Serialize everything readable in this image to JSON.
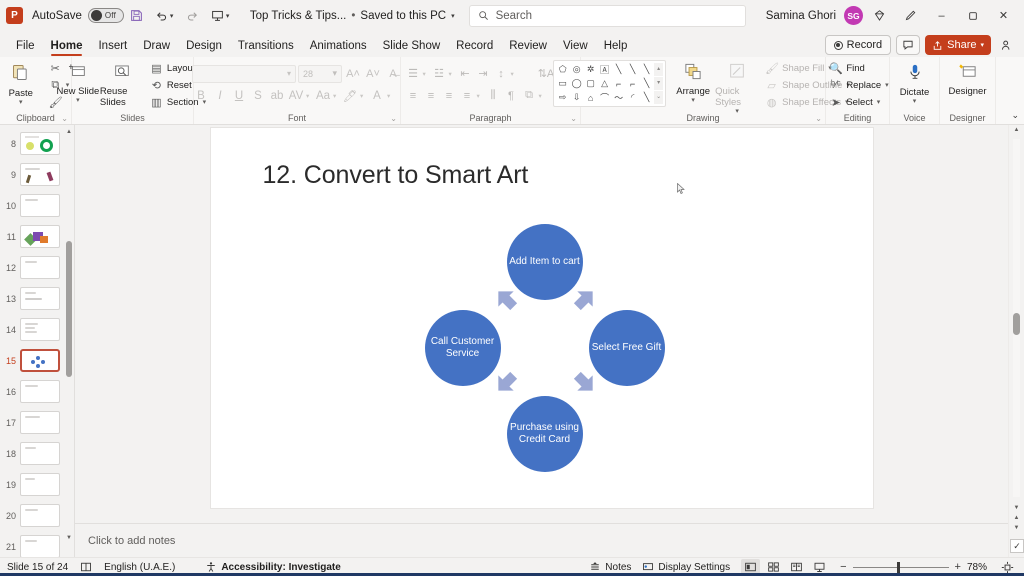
{
  "titlebar": {
    "app_logo": "powerpoint-logo",
    "autosave_label": "AutoSave",
    "autosave_state": "Off",
    "save_icon": "save-icon",
    "undo_icon": "undo-icon",
    "redo_icon": "redo-icon",
    "present_icon": "start-presentation-icon",
    "more_icon": "more-commands-icon",
    "document_title": "Top Tricks & Tips...",
    "save_status": "Saved to this PC",
    "search_placeholder": "Search",
    "search_icon": "search-icon",
    "user_name": "Samina Ghori",
    "user_initials": "SG",
    "diamond_icon": "microsoft-365-icon",
    "pen_icon": "ink-icon",
    "minimize": "–",
    "restore": "❐",
    "close": "✕"
  },
  "tabs": [
    {
      "label": "File",
      "active": false
    },
    {
      "label": "Home",
      "active": true
    },
    {
      "label": "Insert",
      "active": false
    },
    {
      "label": "Draw",
      "active": false
    },
    {
      "label": "Design",
      "active": false
    },
    {
      "label": "Transitions",
      "active": false
    },
    {
      "label": "Animations",
      "active": false
    },
    {
      "label": "Slide Show",
      "active": false
    },
    {
      "label": "Record",
      "active": false
    },
    {
      "label": "Review",
      "active": false
    },
    {
      "label": "View",
      "active": false
    },
    {
      "label": "Help",
      "active": false
    }
  ],
  "tab_actions": {
    "record_label": "Record",
    "comment_icon": "comment-icon",
    "share_label": "Share",
    "share_color": "#c43e1c",
    "people_icon": "share-people-icon"
  },
  "ribbon": {
    "groups": [
      {
        "name": "Clipboard",
        "label": "Clipboard",
        "paste_label": "Paste",
        "cut_icon": "cut-icon",
        "copy_icon": "copy-icon",
        "format_painter_icon": "format-painter-icon",
        "paste_icon": "paste-icon"
      },
      {
        "name": "Slides",
        "label": "Slides",
        "new_slide_label": "New Slide",
        "reuse_slides_label": "Reuse Slides",
        "layout_label": "Layout",
        "reset_label": "Reset",
        "section_label": "Section"
      },
      {
        "name": "Font",
        "label": "Font",
        "font_name": "",
        "font_size": "28",
        "grow_font_icon": "increase-font-size-icon",
        "shrink_font_icon": "decrease-font-size-icon",
        "clear_format_icon": "clear-formatting-icon",
        "bold": "B",
        "italic": "I",
        "underline": "U",
        "shadow": "S",
        "strikethrough_icon": "strikethrough-icon",
        "char_spacing_icon": "character-spacing-icon",
        "change_case": "Aa",
        "highlight_icon": "text-highlight-icon",
        "font_color_icon": "font-color-icon",
        "disabled": true
      },
      {
        "name": "Paragraph",
        "label": "Paragraph",
        "disabled": true
      },
      {
        "name": "Drawing",
        "label": "Drawing",
        "arrange_label": "Arrange",
        "quick_styles_label": "Quick Styles",
        "shape_fill_label": "Shape Fill",
        "shape_outline_label": "Shape Outline",
        "shape_effects_label": "Shape Effects"
      },
      {
        "name": "Editing",
        "label": "Editing",
        "find_label": "Find",
        "replace_label": "Replace",
        "select_label": "Select"
      },
      {
        "name": "Voice",
        "label": "Voice",
        "dictate_label": "Dictate"
      },
      {
        "name": "Designer",
        "label": "Designer",
        "designer_label": "Designer"
      }
    ],
    "collapse_icon": "collapse-ribbon-icon"
  },
  "thumbnails": {
    "slides": [
      {
        "number": "8",
        "selected": false
      },
      {
        "number": "9",
        "selected": false
      },
      {
        "number": "10",
        "selected": false
      },
      {
        "number": "11",
        "selected": false
      },
      {
        "number": "12",
        "selected": false
      },
      {
        "number": "13",
        "selected": false
      },
      {
        "number": "14",
        "selected": false
      },
      {
        "number": "15",
        "selected": true
      },
      {
        "number": "16",
        "selected": false
      },
      {
        "number": "17",
        "selected": false
      },
      {
        "number": "18",
        "selected": false
      },
      {
        "number": "19",
        "selected": false
      },
      {
        "number": "20",
        "selected": false
      },
      {
        "number": "21",
        "selected": false
      }
    ]
  },
  "slide": {
    "title": "12. Convert to Smart Art",
    "smartart": {
      "type": "cycle",
      "node_color": "#4472c4",
      "arrow_color": "#9aa7d4",
      "nodes": [
        {
          "position": "top",
          "text": "Add Item to cart"
        },
        {
          "position": "right",
          "text": "Select Free Gift"
        },
        {
          "position": "bottom",
          "text": "Purchase using Credit Card"
        },
        {
          "position": "left",
          "text": "Call Customer Service"
        }
      ]
    }
  },
  "notes": {
    "placeholder": "Click to add notes"
  },
  "statusbar": {
    "slide_counter": "Slide 15 of 24",
    "slide_icon": "slide-icon",
    "language": "English (U.A.E.)",
    "accessibility_icon": "accessibility-icon",
    "accessibility": "Accessibility: Investigate",
    "notes_label": "Notes",
    "notes_icon": "notes-icon",
    "display_settings_label": "Display Settings",
    "display_settings_icon": "display-settings-icon",
    "view_normal_icon": "normal-view-icon",
    "view_sorter_icon": "slide-sorter-icon",
    "view_reading_icon": "reading-view-icon",
    "view_slideshow_icon": "slideshow-view-icon",
    "zoom_out": "−",
    "zoom_in": "+",
    "zoom_level": "78%",
    "fit_icon": "fit-slide-icon"
  }
}
